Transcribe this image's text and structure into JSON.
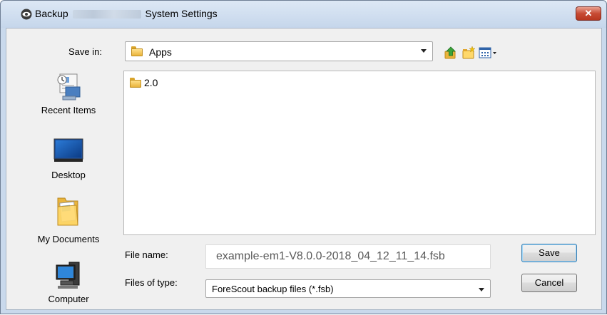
{
  "window": {
    "title_prefix": "Backup",
    "title_suffix": "System Settings",
    "close_label": "✕",
    "icon": "eye-icon"
  },
  "toolbar": {
    "save_in_label": "Save in:",
    "save_in_value": "Apps",
    "icons": [
      "up-folder-icon",
      "new-folder-icon",
      "view-menu-icon"
    ]
  },
  "places": [
    {
      "label": "Recent Items",
      "icon": "recent-items-icon"
    },
    {
      "label": "Desktop",
      "icon": "desktop-icon"
    },
    {
      "label": "My Documents",
      "icon": "my-documents-icon"
    },
    {
      "label": "Computer",
      "icon": "computer-icon"
    }
  ],
  "files": [
    {
      "name": "2.0",
      "icon": "folder-icon"
    }
  ],
  "form": {
    "file_name_label": "File name:",
    "file_name_value": "example-em1-V8.0.0-2018_04_12_11_14.fsb",
    "file_type_label": "Files of type:",
    "file_type_value": "ForeScout backup files (*.fsb)"
  },
  "buttons": {
    "save": "Save",
    "cancel": "Cancel"
  },
  "colors": {
    "title_bar": "#c5d6eb",
    "close_button": "#c74b34",
    "default_button_border": "#3c7fb1"
  }
}
